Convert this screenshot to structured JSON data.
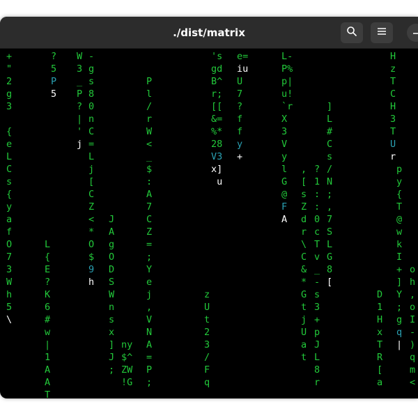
{
  "window": {
    "title": "./dist/matrix"
  },
  "icons": {
    "search": "search-icon",
    "menu": "hamburger-menu-icon",
    "minimize": "minimize-icon"
  },
  "colors": {
    "green": "#22c93a",
    "white": "#ffffff",
    "cyan": "#2aa1b3",
    "background": "#000000",
    "titlebar": "#2c2c2c"
  },
  "columns": [
    {
      "start": 0,
      "chars": [
        "+",
        "\"",
        "2",
        "g",
        "3",
        "",
        "{",
        "e",
        "L",
        "C",
        "s",
        "{",
        "y",
        "a",
        "f",
        "O",
        "7",
        "3",
        "W",
        "h",
        "5",
        "\\"
      ],
      "white": [
        21
      ],
      "cyan": []
    },
    {
      "start": 15,
      "chars": [
        "L",
        "{",
        "E",
        "?",
        "K",
        "6",
        "#",
        "w",
        "|",
        "1",
        "A",
        "A",
        "T"
      ],
      "white": [],
      "cyan": []
    },
    {
      "start": 0,
      "chars": [
        "?",
        "5",
        "P",
        "5"
      ],
      "white": [
        3
      ],
      "cyan": [
        2
      ]
    },
    {
      "start": 0,
      "chars": [
        "W",
        "3",
        "_",
        "P",
        "?",
        "|",
        "'",
        "j"
      ],
      "white": [
        7
      ],
      "cyan": []
    },
    {
      "start": 0,
      "chars": [
        "-",
        "g",
        "s",
        "8",
        "0",
        "n",
        "C",
        "=",
        "L",
        "j",
        "[",
        "C",
        "Z",
        "<",
        "*",
        "O",
        "$",
        "9",
        "h"
      ],
      "white": [
        18
      ],
      "cyan": [
        17
      ]
    },
    {
      "start": 13,
      "chars": [
        "J",
        "A",
        "g",
        "O",
        "D",
        "S",
        "W",
        "n",
        "s",
        "x",
        "]",
        "J",
        ";"
      ],
      "white": [],
      "cyan": []
    },
    {
      "start": 23,
      "chars": [
        "ny",
        "$^",
        "ZW",
        "!G"
      ],
      "white": [],
      "cyan": []
    },
    {
      "start": 2,
      "chars": [
        "P",
        "l",
        "/",
        "r",
        "W",
        "<",
        "_",
        "$",
        ":",
        "A",
        "7",
        "C",
        "Z",
        "=",
        ";",
        "Y",
        "e",
        "j",
        ",",
        "V",
        "N",
        "A",
        "=",
        "P",
        ";"
      ],
      "white": [],
      "cyan": []
    },
    {
      "start": 19,
      "chars": [
        "z",
        "U",
        "t",
        "2",
        "3",
        "/",
        "F",
        "q"
      ],
      "white": [],
      "cyan": []
    },
    {
      "start": 0,
      "chars": [
        "'s",
        "gd",
        "B^",
        "r;",
        "[[",
        "&=",
        "%*",
        "28",
        "V3",
        "x]",
        " u"
      ],
      "white": [
        9,
        10
      ],
      "cyan": [
        8
      ]
    },
    {
      "start": 0,
      "chars": [
        "e=",
        "iu",
        "U",
        "7",
        "?",
        "f",
        "f",
        "y",
        "+"
      ],
      "white": [
        1,
        8
      ],
      "cyan": [
        7
      ]
    },
    {
      "start": 0,
      "chars": [
        "L-",
        "P%",
        "p|",
        "u!",
        "`r",
        "X",
        "3",
        "V",
        "y",
        "l",
        "G",
        "@",
        "F",
        "A"
      ],
      "white": [
        13
      ],
      "cyan": [
        12
      ]
    },
    {
      "start": 9,
      "chars": [
        ",",
        "[",
        "s",
        "Z",
        "d",
        "r",
        "\\",
        "C",
        "&",
        "*",
        "G",
        "t",
        "j",
        "U",
        "a",
        "t"
      ],
      "white": [],
      "cyan": []
    },
    {
      "start": 9,
      "chars": [
        "?",
        "1",
        ":",
        ":",
        "0",
        "c",
        "T",
        "v",
        "_",
        "-",
        "s",
        "3",
        "+",
        "p",
        "J",
        "L",
        "8",
        "r"
      ],
      "white": [],
      "cyan": []
    },
    {
      "start": 4,
      "chars": [
        "]",
        "L",
        "#",
        "C",
        "s",
        "/",
        "N",
        ";",
        ",",
        "7",
        "S",
        "L",
        "G",
        "8",
        "["
      ],
      "white": [
        14
      ],
      "cyan": []
    },
    {
      "start": 19,
      "chars": [
        "D",
        "1",
        "H",
        "x",
        "T",
        "R",
        "[",
        "a"
      ],
      "white": [],
      "cyan": []
    },
    {
      "start": 0,
      "chars": [
        "H",
        "z",
        "T",
        "C",
        "H",
        "3",
        "T",
        "U",
        "r"
      ],
      "white": [
        8
      ],
      "cyan": [
        7
      ]
    },
    {
      "start": 9,
      "chars": [
        "p",
        "y",
        "{",
        "T",
        "@",
        "w",
        "k",
        "I",
        "+",
        "]",
        "Y",
        ";",
        "g",
        "q",
        "|"
      ],
      "white": [
        14
      ],
      "cyan": [
        13
      ]
    },
    {
      "start": 17,
      "chars": [
        "o",
        "h",
        ",",
        "o",
        "I",
        "-",
        ")",
        "q",
        "m",
        "<"
      ],
      "white": [],
      "cyan": []
    }
  ]
}
